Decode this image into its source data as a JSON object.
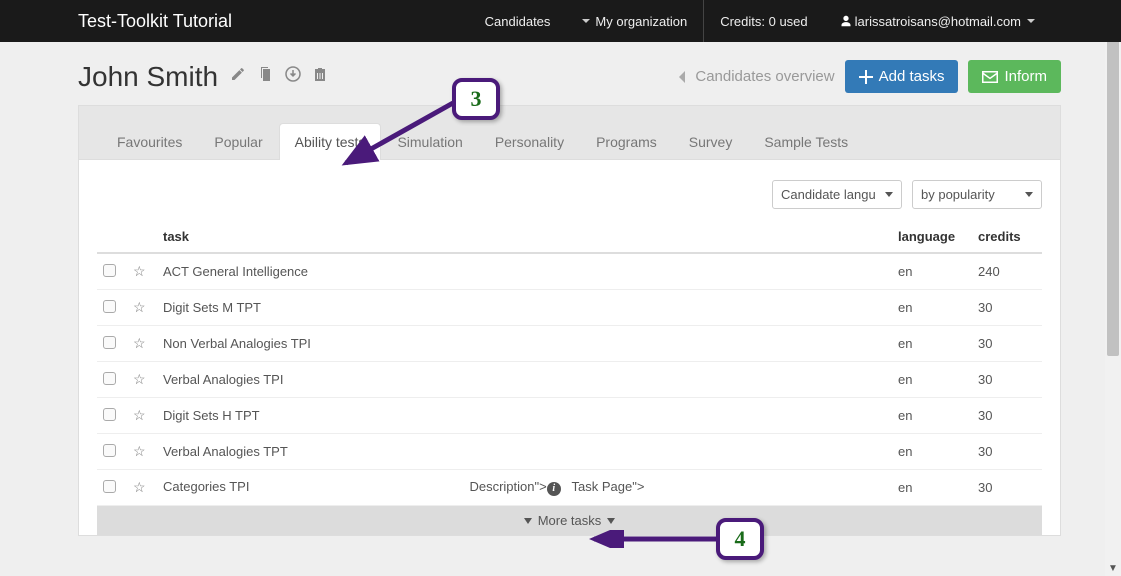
{
  "topbar": {
    "brand": "Test-Toolkit Tutorial",
    "nav": {
      "candidates": "Candidates",
      "my_org": "My organization",
      "credits": "Credits: 0 used",
      "user": "larissatroisans@hotmail.com"
    }
  },
  "header": {
    "title": "John Smith",
    "overview": "Candidates overview",
    "add_tasks": "Add tasks",
    "inform": "Inform"
  },
  "tabs": [
    {
      "label": "Favourites",
      "active": false
    },
    {
      "label": "Popular",
      "active": false
    },
    {
      "label": "Ability tests",
      "active": true
    },
    {
      "label": "Simulation",
      "active": false
    },
    {
      "label": "Personality",
      "active": false
    },
    {
      "label": "Programs",
      "active": false
    },
    {
      "label": "Survey",
      "active": false
    },
    {
      "label": "Sample Tests",
      "active": false
    }
  ],
  "filters": {
    "language": "Candidate langu",
    "sort": "by popularity"
  },
  "columns": {
    "task": "task",
    "language": "language",
    "credits": "credits"
  },
  "rows": [
    {
      "task": "ACT General Intelligence",
      "language": "en",
      "credits": "240",
      "extra": ""
    },
    {
      "task": "Digit Sets M TPT",
      "language": "en",
      "credits": "30",
      "extra": ""
    },
    {
      "task": "Non Verbal Analogies TPI",
      "language": "en",
      "credits": "30",
      "extra": ""
    },
    {
      "task": "Verbal Analogies TPI",
      "language": "en",
      "credits": "30",
      "extra": ""
    },
    {
      "task": "Digit Sets H TPT",
      "language": "en",
      "credits": "30",
      "extra": ""
    },
    {
      "task": "Verbal Analogies TPT",
      "language": "en",
      "credits": "30",
      "extra": ""
    },
    {
      "task": "Categories TPI",
      "language": "en",
      "credits": "30",
      "extra": "yes"
    }
  ],
  "row_extra": {
    "description": "Description\">",
    "task_page": "Task Page\">"
  },
  "more_tasks": "More tasks",
  "callouts": {
    "c3": "3",
    "c4": "4"
  }
}
